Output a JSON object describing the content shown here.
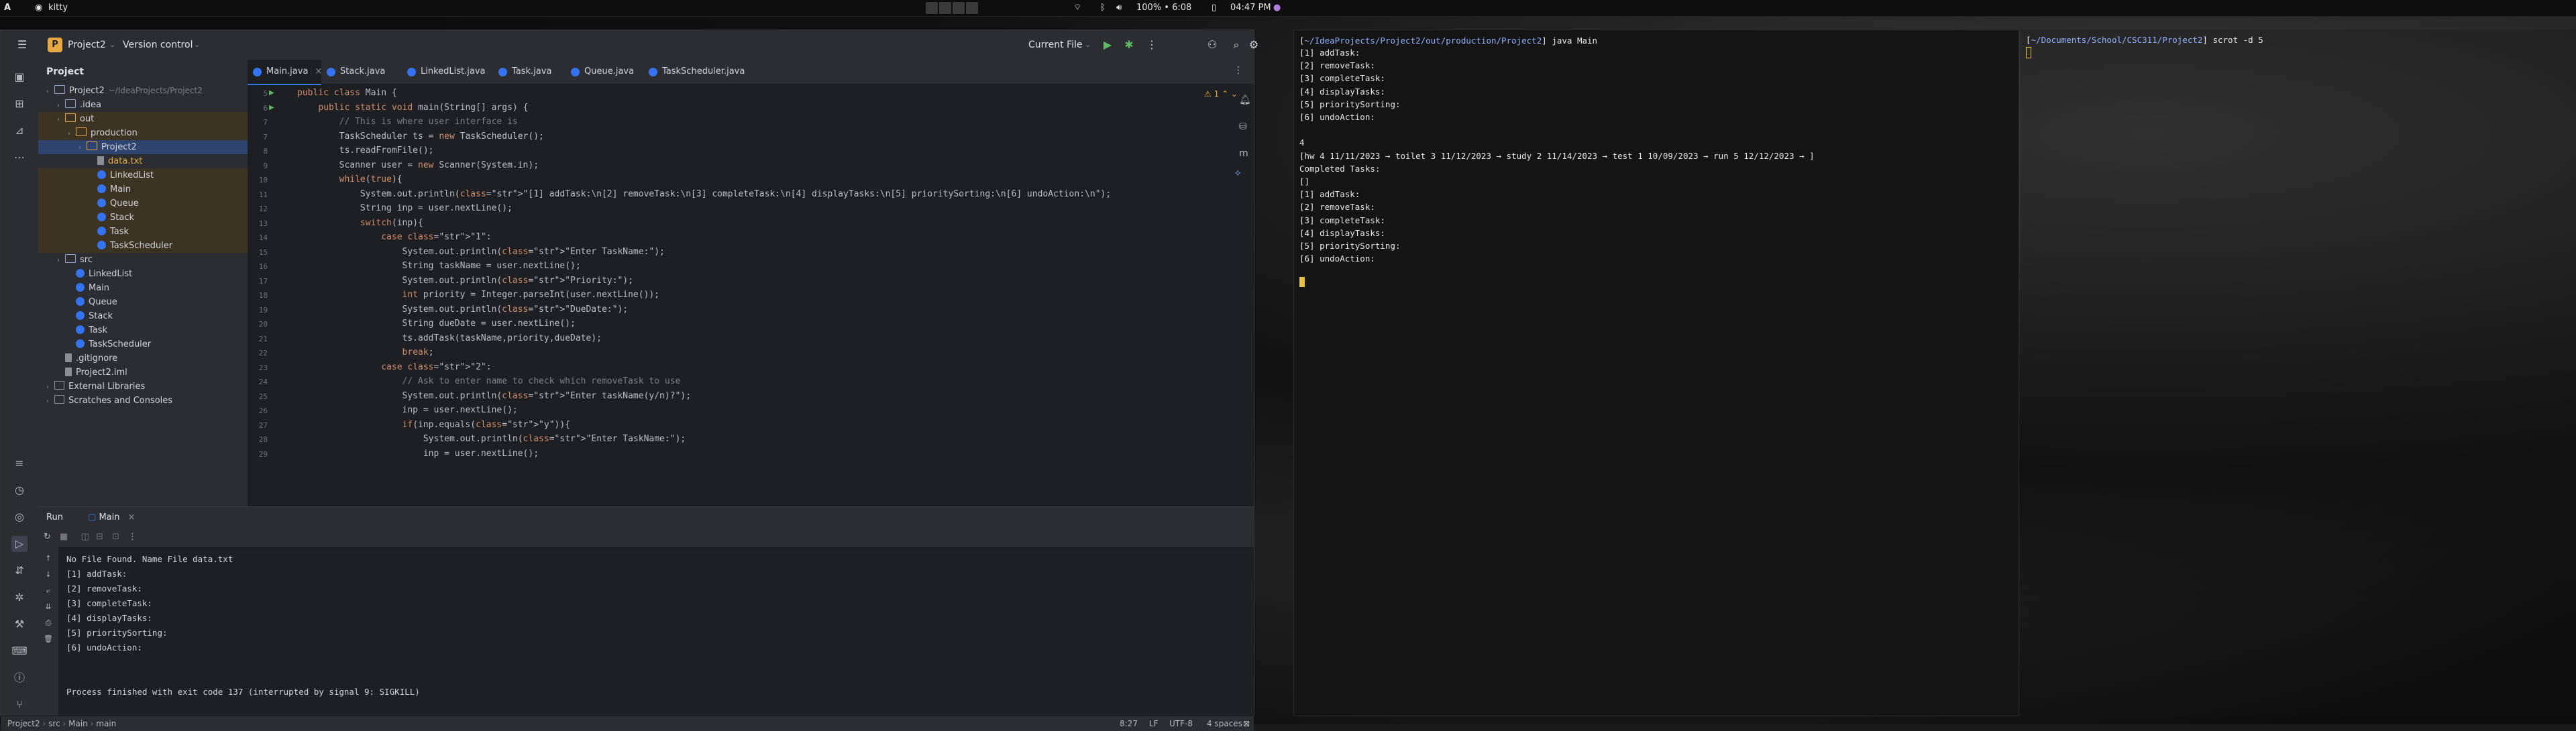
{
  "topbar": {
    "app_title": "kitty",
    "workspace": "A",
    "battery": "100% • 6:08",
    "clock": "04:47 PM"
  },
  "ide": {
    "project_name": "Project2",
    "vcs": "Version control",
    "run_config": "Current File",
    "project_panel_title": "Project",
    "tree": [
      {
        "label": "Project2",
        "extra": "~/IdeaProjects/Project2",
        "indent": 0,
        "icon": "folder",
        "style": ""
      },
      {
        "label": ".idea",
        "extra": "",
        "indent": 1,
        "icon": "folder",
        "style": ""
      },
      {
        "label": "out",
        "extra": "",
        "indent": 1,
        "icon": "folder-orange",
        "style": "hl"
      },
      {
        "label": "production",
        "extra": "",
        "indent": 2,
        "icon": "folder-orange",
        "style": "hl"
      },
      {
        "label": "Project2",
        "extra": "",
        "indent": 3,
        "icon": "folder-orange",
        "style": "sel"
      },
      {
        "label": "data.txt",
        "extra": "",
        "indent": 4,
        "icon": "file",
        "style": "hl-text"
      },
      {
        "label": "LinkedList",
        "extra": "",
        "indent": 4,
        "icon": "class",
        "style": "hl"
      },
      {
        "label": "Main",
        "extra": "",
        "indent": 4,
        "icon": "class",
        "style": "hl"
      },
      {
        "label": "Queue",
        "extra": "",
        "indent": 4,
        "icon": "class",
        "style": "hl"
      },
      {
        "label": "Stack",
        "extra": "",
        "indent": 4,
        "icon": "class",
        "style": "hl"
      },
      {
        "label": "Task",
        "extra": "",
        "indent": 4,
        "icon": "class",
        "style": "hl"
      },
      {
        "label": "TaskScheduler",
        "extra": "",
        "indent": 4,
        "icon": "class",
        "style": "hl"
      },
      {
        "label": "src",
        "extra": "",
        "indent": 1,
        "icon": "folder",
        "style": ""
      },
      {
        "label": "LinkedList",
        "extra": "",
        "indent": 2,
        "icon": "class",
        "style": ""
      },
      {
        "label": "Main",
        "extra": "",
        "indent": 2,
        "icon": "class",
        "style": ""
      },
      {
        "label": "Queue",
        "extra": "",
        "indent": 2,
        "icon": "class",
        "style": ""
      },
      {
        "label": "Stack",
        "extra": "",
        "indent": 2,
        "icon": "class",
        "style": ""
      },
      {
        "label": "Task",
        "extra": "",
        "indent": 2,
        "icon": "class",
        "style": ""
      },
      {
        "label": "TaskScheduler",
        "extra": "",
        "indent": 2,
        "icon": "class",
        "style": ""
      },
      {
        "label": ".gitignore",
        "extra": "",
        "indent": 1,
        "icon": "file",
        "style": ""
      },
      {
        "label": "Project2.iml",
        "extra": "",
        "indent": 1,
        "icon": "file",
        "style": ""
      },
      {
        "label": "External Libraries",
        "extra": "",
        "indent": 0,
        "icon": "lib",
        "style": ""
      },
      {
        "label": "Scratches and Consoles",
        "extra": "",
        "indent": 0,
        "icon": "lib",
        "style": ""
      }
    ],
    "tabs": [
      "Main.java",
      "Stack.java",
      "LinkedList.java",
      "Task.java",
      "Queue.java",
      "TaskScheduler.java"
    ],
    "warning_count": "1",
    "code_lines": [
      {
        "n": "5",
        "t": "public class Main {"
      },
      {
        "n": "6",
        "t": "    public static void main(String[] args) {"
      },
      {
        "n": "7",
        "t": "        // This is where user interface is"
      },
      {
        "n": "7",
        "t": "        TaskScheduler ts = new TaskScheduler();"
      },
      {
        "n": "8",
        "t": "        ts.readFromFile();"
      },
      {
        "n": "9",
        "t": "        Scanner user = new Scanner(System.in);"
      },
      {
        "n": "10",
        "t": "        while(true){"
      },
      {
        "n": "11",
        "t": "            System.out.println(\"[1] addTask:\\n[2] removeTask:\\n[3] completeTask:\\n[4] displayTasks:\\n[5] prioritySorting:\\n[6] undoAction:\\n\");"
      },
      {
        "n": "12",
        "t": "            String inp = user.nextLine();"
      },
      {
        "n": "13",
        "t": "            switch(inp){"
      },
      {
        "n": "14",
        "t": "                case \"1\":"
      },
      {
        "n": "15",
        "t": "                    System.out.println(\"Enter TaskName:\");"
      },
      {
        "n": "16",
        "t": "                    String taskName = user.nextLine();"
      },
      {
        "n": "17",
        "t": "                    System.out.println(\"Priority:\");"
      },
      {
        "n": "18",
        "t": "                    int priority = Integer.parseInt(user.nextLine());"
      },
      {
        "n": "19",
        "t": "                    System.out.println(\"DueDate:\");"
      },
      {
        "n": "20",
        "t": "                    String dueDate = user.nextLine();"
      },
      {
        "n": "21",
        "t": "                    ts.addTask(taskName,priority,dueDate);"
      },
      {
        "n": "22",
        "t": "                    break;"
      },
      {
        "n": "23",
        "t": "                case \"2\":"
      },
      {
        "n": "24",
        "t": "                    // Ask to enter name to check which removeTask to use"
      },
      {
        "n": "25",
        "t": "                    System.out.println(\"Enter taskName(y/n)?\");"
      },
      {
        "n": "26",
        "t": "                    inp = user.nextLine();"
      },
      {
        "n": "27",
        "t": "                    if(inp.equals(\"y\")){"
      },
      {
        "n": "28",
        "t": "                        System.out.println(\"Enter TaskName:\");"
      },
      {
        "n": "29",
        "t": "                        inp = user.nextLine();"
      }
    ],
    "run_tab_label": "Run",
    "run_config_tab": "Main",
    "run_output": [
      "No File Found. Name File data.txt",
      "[1] addTask:",
      "[2] removeTask:",
      "[3] completeTask:",
      "[4] displayTasks:",
      "[5] prioritySorting:",
      "[6] undoAction:",
      "",
      "",
      "Process finished with exit code 137 (interrupted by signal 9: SIGKILL)"
    ],
    "status": {
      "crumbs": [
        "Project2",
        "src",
        "Main",
        "main"
      ],
      "position": "8:27",
      "line_sep": "LF",
      "encoding": "UTF-8",
      "indent": "4 spaces"
    }
  },
  "term1": {
    "prompt_path": "~/IdeaProjects/Project2/out/production/Project2",
    "command": "java Main",
    "lines": [
      "[1] addTask:",
      "[2] removeTask:",
      "[3] completeTask:",
      "[4] displayTasks:",
      "[5] prioritySorting:",
      "[6] undoAction:",
      "",
      "4",
      "[hw 4 11/11/2023 → toilet 3 11/12/2023 → study 2 11/14/2023 → test 1 10/09/2023 → run 5 12/12/2023 → ]",
      "Completed Tasks:",
      "[]",
      "[1] addTask:",
      "[2] removeTask:",
      "[3] completeTask:",
      "[4] displayTasks:",
      "[5] prioritySorting:",
      "[6] undoAction:"
    ]
  },
  "term2": {
    "prompt_path": "~/Documents/School/CSC311/Project2",
    "command": "scrot -d 5"
  },
  "colors": {
    "accent": "#3574f0",
    "folder_highlight": "#e5a843",
    "terminal_path": "#8fb3ff",
    "cursor": "#e5c043"
  }
}
